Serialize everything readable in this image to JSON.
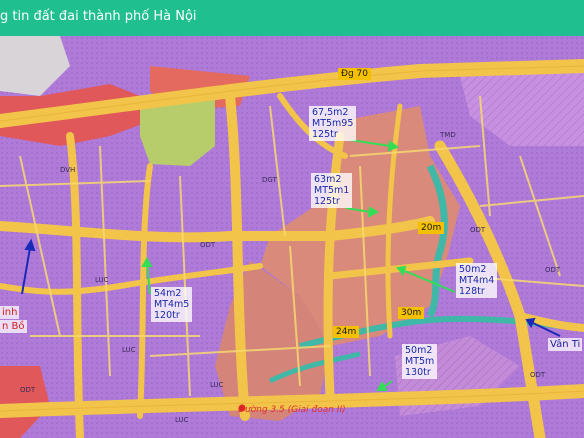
{
  "header": {
    "title": "g tin đất đai thành phố Hà Nội",
    "background": "#1fbf8f"
  },
  "colors": {
    "residential": "#b07ad8",
    "road": "#f3c44a",
    "mixed": "#d98a7a",
    "commercial": "#e0585a",
    "green": "#b7cc6a",
    "water": "#3fb8a8",
    "label_text": "#1a2aa8",
    "pointer_green": "#33dd55",
    "pointer_blue": "#1a2ab8"
  },
  "map": {
    "road_labels": {
      "d70": "Đg 70",
      "w20": "20m",
      "w30": "30m",
      "w24": "24m"
    },
    "road_name_bottom": "Đường 3.5 (Giai đoạn II)",
    "parcels": [
      {
        "area": "67,5m2",
        "frontage": "MT5m95",
        "price": "125tr"
      },
      {
        "area": "63m2",
        "frontage": "MT5m1",
        "price": "125tr"
      },
      {
        "area": "50m2",
        "frontage": "MT4m4",
        "price": "128tr"
      },
      {
        "area": "54m2",
        "frontage": "MT4m5",
        "price": "120tr"
      },
      {
        "area": "50m2",
        "frontage": "MT5m",
        "price": "130tr"
      }
    ],
    "left_labels": [
      "inh",
      "n Bồ"
    ],
    "right_label": "Vân Ti",
    "zone_codes": [
      "ODT",
      "LUC",
      "DGT",
      "ODT",
      "LUC",
      "ODT",
      "DVH",
      "ODT",
      "LUC",
      "ODT",
      "TMD",
      "LUC"
    ]
  }
}
